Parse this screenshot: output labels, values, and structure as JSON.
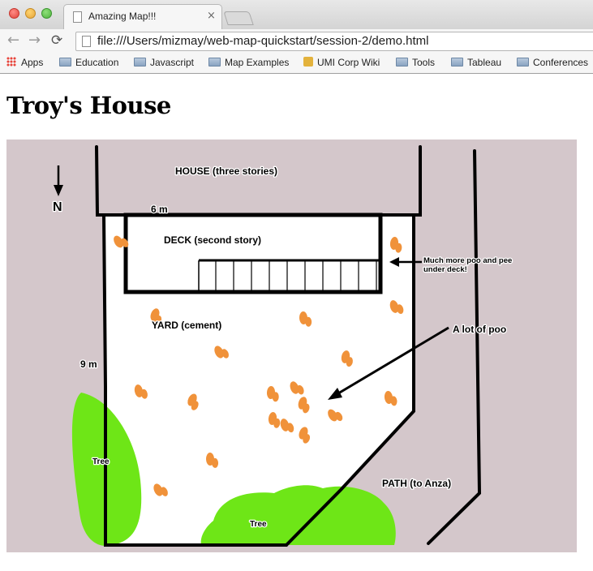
{
  "browser": {
    "tab_title": "Amazing Map!!!",
    "tab_close": "×",
    "url": "file:///Users/mizmay/web-map-quickstart/session-2/demo.html",
    "nav": {
      "back": "←",
      "forward": "→",
      "reload": "⟳"
    },
    "bookmarks": [
      {
        "label": "Apps",
        "icon": "apps-icon"
      },
      {
        "label": "Education",
        "icon": "folder-icon"
      },
      {
        "label": "Javascript",
        "icon": "folder-icon"
      },
      {
        "label": "Map Examples",
        "icon": "folder-icon"
      },
      {
        "label": "UMI Corp Wiki",
        "icon": "wiki-icon"
      },
      {
        "label": "Tools",
        "icon": "folder-icon"
      },
      {
        "label": "Tableau",
        "icon": "folder-icon"
      },
      {
        "label": "Conferences",
        "icon": "folder-icon"
      }
    ]
  },
  "page": {
    "heading": "Troy's House"
  },
  "map": {
    "background_color": "#d4c7cb",
    "yard_color": "#ffffff",
    "tree_color": "#6ee617",
    "poo_color": "#f0923a",
    "north": "N",
    "labels": {
      "house": "HOUSE (three stories)",
      "deck_width": "6 m",
      "deck": "DECK (second story)",
      "deck_note_line1": "Much more poo and pee",
      "deck_note_line2": "under deck!",
      "yard": "YARD (cement)",
      "poo_note": "A lot of poo",
      "yard_height": "9 m",
      "tree_left": "Tree",
      "tree_bottom": "Tree",
      "path": "PATH (to Anza)"
    }
  }
}
